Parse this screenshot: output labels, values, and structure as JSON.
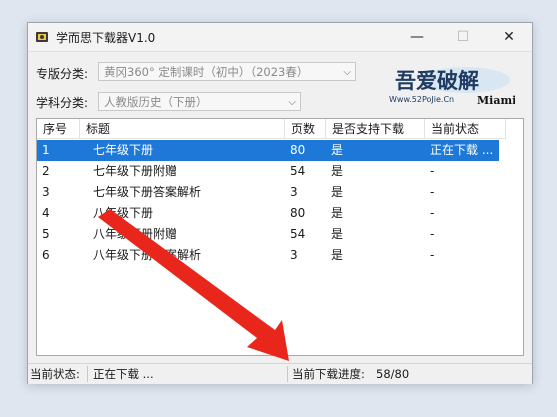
{
  "window": {
    "title": "学而思下载器V1.0",
    "min_glyph": "—",
    "max_glyph": "☐",
    "close_glyph": "✕"
  },
  "form": {
    "album_label": "专版分类:",
    "album_value": "黄冈360° 定制课时（初中）（2023春）",
    "subject_label": "学科分类:",
    "subject_value": "人教版历史（下册）"
  },
  "logo": {
    "main_text": "吾爱破解",
    "url_text": "Www.52PoJie.Cn",
    "side_text": "Miami"
  },
  "table": {
    "columns": [
      "序号",
      "标题",
      "页数",
      "是否支持下载",
      "当前状态"
    ],
    "rows": [
      {
        "no": "1",
        "title": "七年级下册",
        "pages": "80",
        "support": "是",
        "status": "正在下载 ...",
        "selected": true
      },
      {
        "no": "2",
        "title": "七年级下册附赠",
        "pages": "54",
        "support": "是",
        "status": "-",
        "selected": false
      },
      {
        "no": "3",
        "title": "七年级下册答案解析",
        "pages": "3",
        "support": "是",
        "status": "-",
        "selected": false
      },
      {
        "no": "4",
        "title": "八年级下册",
        "pages": "80",
        "support": "是",
        "status": "-",
        "selected": false
      },
      {
        "no": "5",
        "title": "八年级下册附赠",
        "pages": "54",
        "support": "是",
        "status": "-",
        "selected": false
      },
      {
        "no": "6",
        "title": "八年级下册答案解析",
        "pages": "3",
        "support": "是",
        "status": "-",
        "selected": false
      }
    ]
  },
  "status": {
    "state_label": "当前状态:",
    "state_value": "正在下载 ...",
    "progress_label": "当前下载进度:",
    "progress_value": "58/80"
  },
  "colors": {
    "selection": "#1e78d7",
    "annotation_arrow": "#e8261c"
  }
}
